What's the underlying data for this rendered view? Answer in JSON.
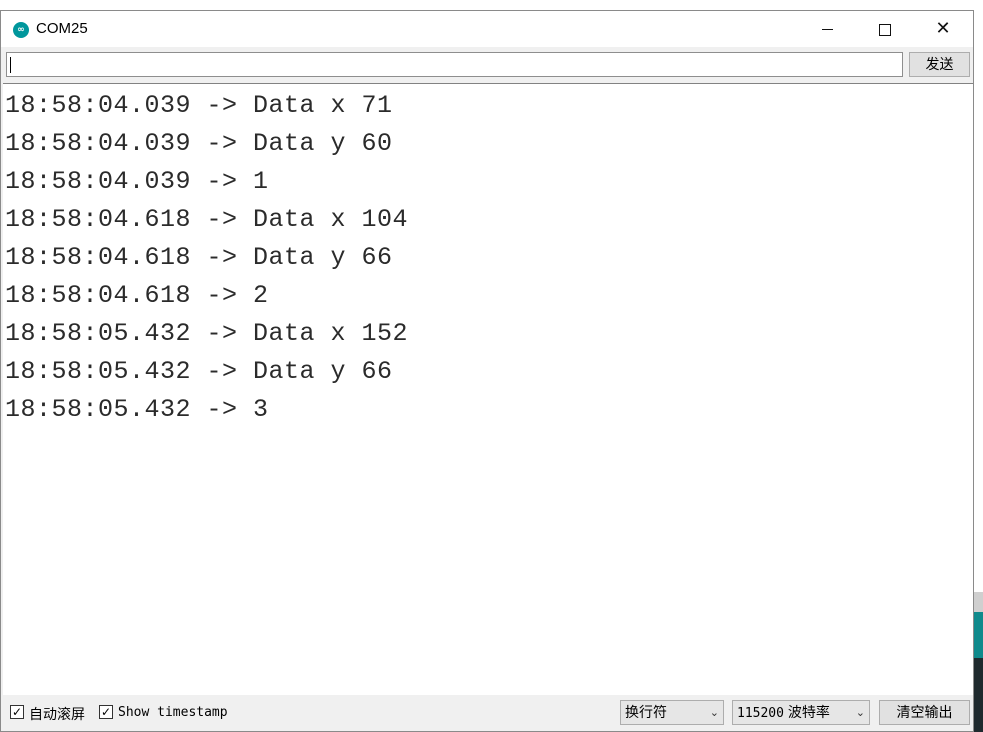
{
  "window": {
    "title": "COM25",
    "icon": "arduino-icon",
    "controls": {
      "minimize": "minimize-icon",
      "maximize": "maximize-icon",
      "close": "close-icon"
    }
  },
  "send_bar": {
    "input_value": "",
    "send_label": "发送"
  },
  "output": {
    "lines": [
      "18:58:04.039 -> Data x 71",
      "18:58:04.039 -> Data y 60",
      "18:58:04.039 -> 1",
      "18:58:04.618 -> Data x 104",
      "18:58:04.618 -> Data y 66",
      "18:58:04.618 -> 2",
      "18:58:05.432 -> Data x 152",
      "18:58:05.432 -> Data y 66",
      "18:58:05.432 -> 3"
    ]
  },
  "footer": {
    "autoscroll": {
      "label": "自动滚屏",
      "checked": true
    },
    "timestamp": {
      "label": "Show timestamp",
      "checked": true
    },
    "line_ending": {
      "selected": "换行符"
    },
    "baud": {
      "value": "115200",
      "unit": "波特率"
    },
    "clear_label": "清空输出"
  },
  "colors": {
    "accent_teal": "#00979c",
    "window_bg": "#f0f0f0",
    "output_bg": "#ffffff",
    "text": "#2b2b2b"
  }
}
